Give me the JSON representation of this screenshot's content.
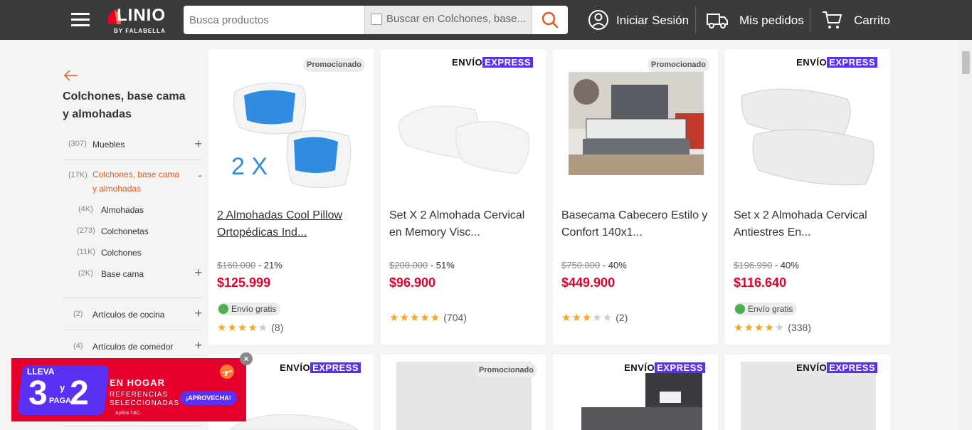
{
  "header": {
    "logo_text": "LINIO",
    "logo_sub": "BY FALABELLA",
    "search_placeholder": "Busca productos",
    "search_category": "Buscar en Colchones, base...",
    "login": "Iniciar Sesión",
    "orders": "Mis pedidos",
    "cart": "Carrito",
    "icons": [
      "menu-icon",
      "search-icon",
      "user-icon",
      "truck-icon",
      "cart-icon"
    ]
  },
  "sidebar": {
    "title": "Colchones, base cama y almohadas",
    "categories": [
      {
        "count": "(307)",
        "name": "Muebles",
        "toggle": "+"
      },
      {
        "count": "(17K)",
        "name": "Colchones, base cama y almohadas",
        "toggle": "-"
      },
      {
        "count": "(4K)",
        "name": "Almohadas",
        "toggle": ""
      },
      {
        "count": "(273)",
        "name": "Colchonetas",
        "toggle": ""
      },
      {
        "count": "(11K)",
        "name": "Colchones",
        "toggle": ""
      },
      {
        "count": "(2K)",
        "name": "Base cama",
        "toggle": "+"
      },
      {
        "count": "(2)",
        "name": "Artículos de cocina",
        "toggle": "+"
      },
      {
        "count": "(4)",
        "name": "Artículos de comedor",
        "toggle": "+"
      }
    ],
    "active_color": "#e85a1c"
  },
  "badges": {
    "promoted": "Promocionado",
    "express_1": "ENVÍO",
    "express_2": "EXPRESS",
    "free_shipping": "Envío gratis"
  },
  "products": [
    {
      "title": "2 Almohadas Cool Pillow Ortopédicas Ind...",
      "old_price": "$160.000",
      "discount": "- 21%",
      "price": "$125.999",
      "rating": 4,
      "reviews": "(8)"
    },
    {
      "title": "Set X 2 Almohada Cervical en Memory Visc...",
      "old_price": "$200.000",
      "discount": "- 51%",
      "price": "$96.900",
      "rating": 5,
      "reviews": "(704)"
    },
    {
      "title": "Basecama Cabecero Estilo y Confort 140x1...",
      "old_price": "$750.000",
      "discount": "- 40%",
      "price": "$449.900",
      "rating": 3,
      "reviews": "(2)"
    },
    {
      "title": "Set x 2 Almohada Cervical Antiestres En...",
      "old_price": "$196.990",
      "discount": "- 40%",
      "price": "$116.640",
      "rating": 4,
      "reviews": "(338)"
    }
  ],
  "promo": {
    "lleva": "LLEVA",
    "three": "3",
    "y": "y",
    "two": "2",
    "paga": "PAGA",
    "hogar": "EN HOGAR",
    "referencias": "REFERENCIAS SELECCIONADAS",
    "aplica": "Aplica T&C.",
    "cta": "¡APROVECHA!",
    "close": "×"
  },
  "colors": {
    "price": "#e4002b",
    "express": "#5a31f4",
    "header": "#3b3b3b",
    "star": "#f5a623"
  }
}
